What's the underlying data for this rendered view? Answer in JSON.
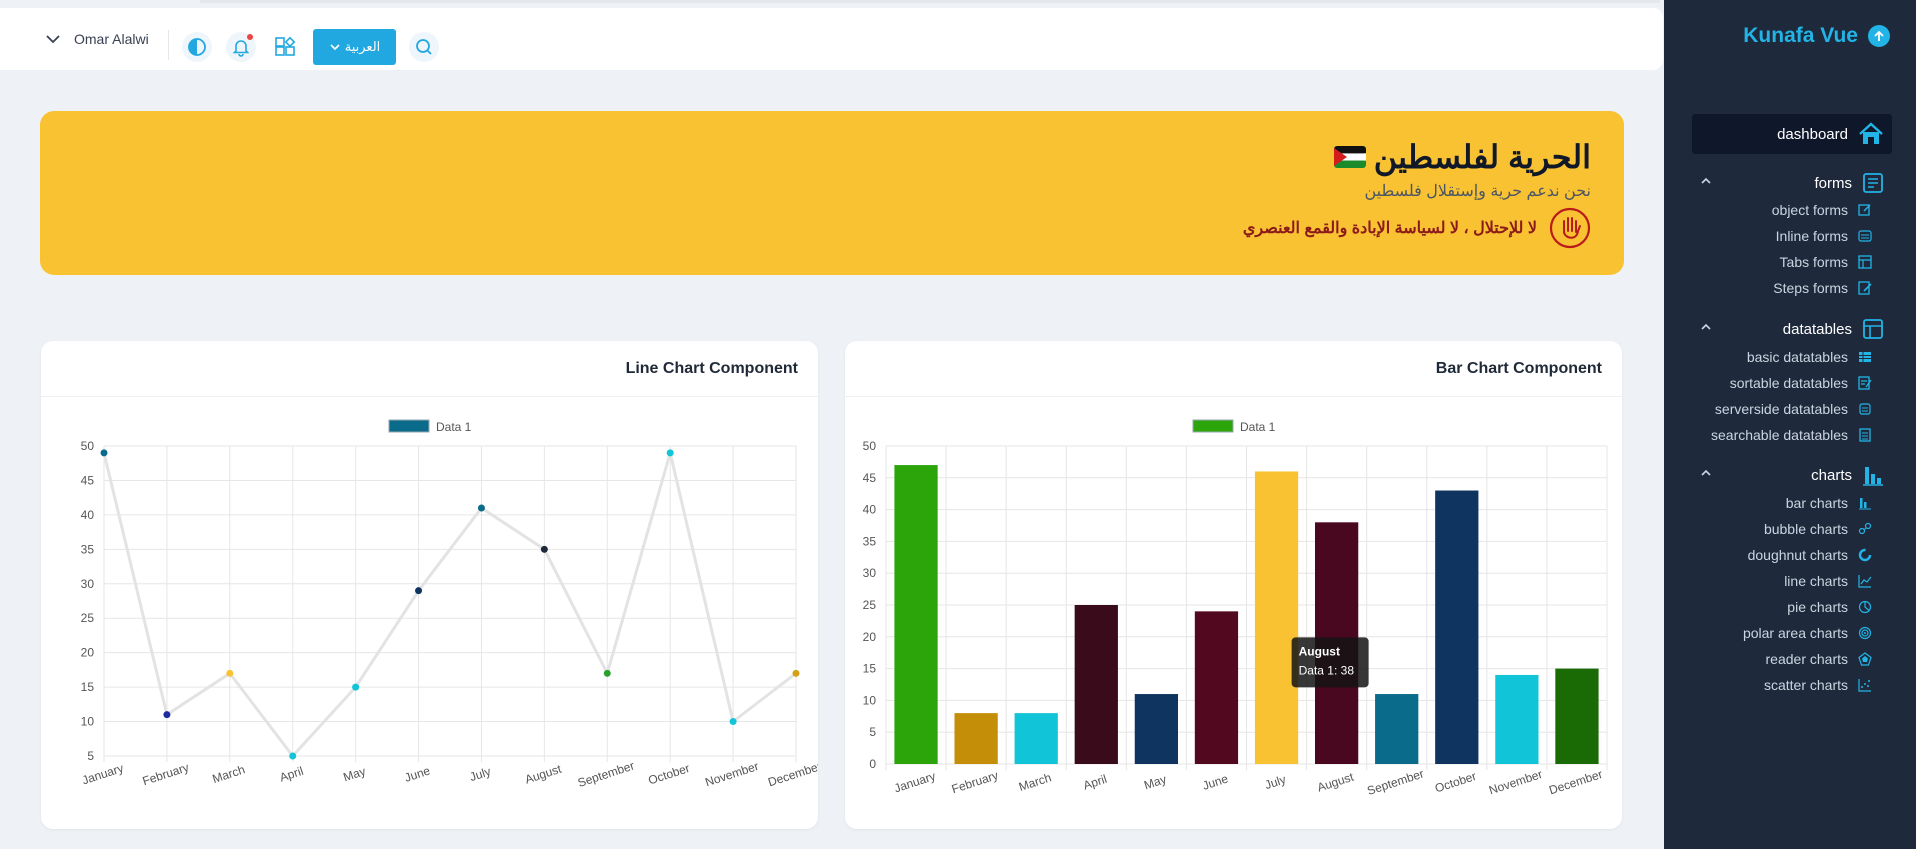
{
  "sidebar": {
    "brand": "Kunafa Vue",
    "active_item": "dashboard",
    "groups": [
      {
        "label": "forms",
        "items": [
          "object forms",
          "Inline forms",
          "Tabs forms",
          "Steps forms"
        ]
      },
      {
        "label": "datatables",
        "items": [
          "basic datatables",
          "sortable datatables",
          "serverside datatables",
          "searchable datatables"
        ]
      },
      {
        "label": "charts",
        "items": [
          "bar charts",
          "bubble charts",
          "doughnut charts",
          "line charts",
          "pie charts",
          "polar area charts",
          "reader charts",
          "scatter charts"
        ]
      }
    ]
  },
  "topbar": {
    "user_name": "Omar Alalwi",
    "language_button": "العربية",
    "icons": [
      "chevron-down-icon",
      "theme-toggle-icon",
      "bell-icon",
      "apps-icon",
      "search-icon"
    ]
  },
  "banner": {
    "title": "الحرية لفلسطين",
    "subtitle": "نحن ندعم حرية وإستقلال فلسطين",
    "message": "لا للإحتلال ، لا لسياسة الإبادة والقمع العنصري",
    "bg_color": "#f9c232"
  },
  "cards": {
    "line": {
      "title": "Line Chart Component"
    },
    "bar": {
      "title": "Bar Chart Component"
    }
  },
  "chart_data": [
    {
      "type": "line",
      "title": "Line Chart Component",
      "categories": [
        "January",
        "February",
        "March",
        "April",
        "May",
        "June",
        "July",
        "August",
        "September",
        "October",
        "November",
        "December"
      ],
      "series": [
        {
          "name": "Data 1",
          "values": [
            49,
            11,
            17,
            5,
            15,
            29,
            41,
            35,
            17,
            49,
            10,
            17
          ]
        }
      ],
      "point_colors": [
        "#0a6b8a",
        "#1e2b9e",
        "#f9c232",
        "#12c4d8",
        "#12c4d8",
        "#0f3460",
        "#0a6b8a",
        "#1e293b",
        "#2ca02c",
        "#12c4d8",
        "#12c4d8",
        "#d4a017"
      ],
      "line_color": "#e3e3e3",
      "legend_color": "#0a6b8a",
      "ylim": [
        5,
        50
      ],
      "yticks": [
        5,
        10,
        15,
        20,
        25,
        30,
        35,
        40,
        45,
        50
      ],
      "grid": true,
      "legend": "top-center"
    },
    {
      "type": "bar",
      "title": "Bar Chart Component",
      "categories": [
        "January",
        "February",
        "March",
        "April",
        "May",
        "June",
        "July",
        "August",
        "September",
        "October",
        "November",
        "December"
      ],
      "series": [
        {
          "name": "Data 1",
          "values": [
            47,
            8,
            8,
            25,
            11,
            24,
            46,
            38,
            11,
            43,
            14,
            15
          ]
        }
      ],
      "bar_colors": [
        "#2ca50a",
        "#c48e08",
        "#12c4d8",
        "#3a0b1a",
        "#0f3460",
        "#52081e",
        "#f9c232",
        "#4a0720",
        "#0a6b8a",
        "#0f3460",
        "#12c4d8",
        "#1a6a05"
      ],
      "legend_color": "#2ca50a",
      "ylim": [
        0,
        50
      ],
      "yticks": [
        0,
        5,
        10,
        15,
        20,
        25,
        30,
        35,
        40,
        45,
        50
      ],
      "grid": true,
      "legend": "top-center",
      "tooltip": {
        "title": "August",
        "text": "Data 1: 38"
      }
    }
  ]
}
